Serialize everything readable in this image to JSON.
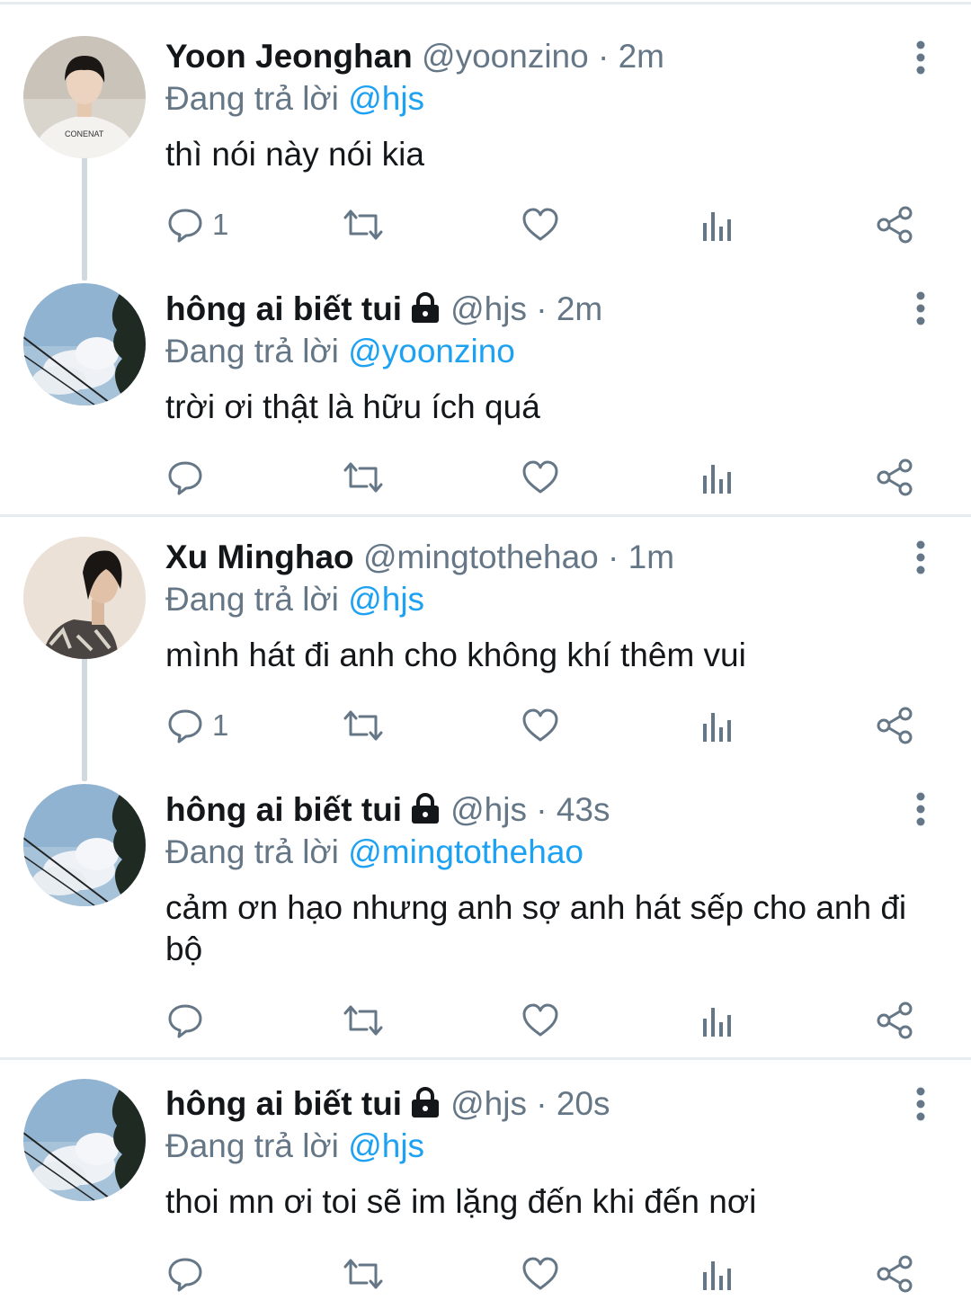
{
  "reply_prefix": "Đang trả lời",
  "tweets": [
    {
      "name": "Yoon Jeonghan",
      "handle": "@yoonzino",
      "time": "2m",
      "reply_to": "@hjs",
      "text": "thì nói này nói kia",
      "reply_count": "1",
      "locked": false,
      "avatar": "jeonghan"
    },
    {
      "name": "hông ai biết tui",
      "handle": "@hjs",
      "time": "2m",
      "reply_to": "@yoonzino",
      "text": "trời ơi thật là hữu ích quá",
      "reply_count": "",
      "locked": true,
      "avatar": "sky"
    },
    {
      "name": "Xu Minghao",
      "handle": "@mingtothehao",
      "time": "1m",
      "reply_to": "@hjs",
      "text": "mình hát đi anh cho không khí thêm vui",
      "reply_count": "1",
      "locked": false,
      "avatar": "minghao"
    },
    {
      "name": "hông ai biết tui",
      "handle": "@hjs",
      "time": "43s",
      "reply_to": "@mingtothehao",
      "text": "cảm ơn hạo nhưng anh sợ anh hát sếp cho anh đi bộ",
      "reply_count": "",
      "locked": true,
      "avatar": "sky"
    },
    {
      "name": "hông ai biết tui",
      "handle": "@hjs",
      "time": "20s",
      "reply_to": "@hjs",
      "text": "thoi mn ơi toi sẽ im lặng đến khi đến nơi",
      "reply_count": "",
      "locked": true,
      "avatar": "sky"
    }
  ],
  "icons": {
    "reply": "reply-icon",
    "retweet": "retweet-icon",
    "like": "heart-icon",
    "analytics": "analytics-icon",
    "share": "share-icon",
    "more": "more-vertical-icon",
    "lock": "lock-icon"
  },
  "colors": {
    "mention": "#1da1f2",
    "secondary_text": "#657786",
    "divider": "#e6ecf0",
    "thread_line": "#cfd9de"
  }
}
